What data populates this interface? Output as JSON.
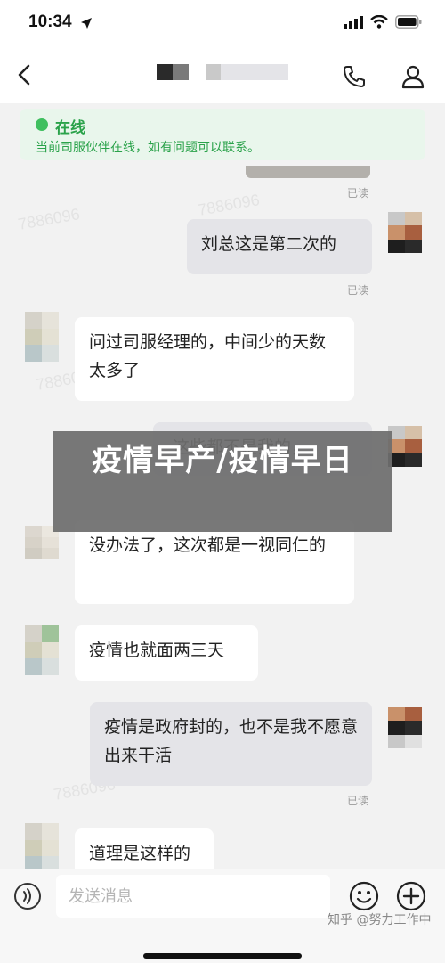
{
  "status_bar": {
    "time": "10:34",
    "icons": [
      "location-arrow-icon",
      "signal-icon",
      "wifi-icon",
      "battery-icon"
    ]
  },
  "header": {
    "back_icon": "back-chevron-icon",
    "title_redacted": true,
    "call_icon": "phone-icon",
    "profile_icon": "person-icon"
  },
  "online_banner": {
    "title": "在线",
    "description": "当前司服伙伴在线，如有问题可以联系。",
    "color": "#2aa24a"
  },
  "watermark_text": "7886096",
  "messages": [
    {
      "side": "right",
      "text": "刘总这是第二次的",
      "read": "已读"
    },
    {
      "side": "left",
      "text": "问过司服经理的，中间少的天数太多了"
    },
    {
      "side": "right",
      "text": "这些都不是我的，",
      "obscured": true
    },
    {
      "side": "left",
      "text": "没办法了，这次都是一视同仁的"
    },
    {
      "side": "left",
      "text": "疫情也就面两三天"
    },
    {
      "side": "right",
      "text": "疫情是政府封的，也不是我不愿意出来干活",
      "read": "已读"
    },
    {
      "side": "left",
      "text": "道理是这样的"
    }
  ],
  "read_labels": [
    "已读",
    "已读",
    "已读"
  ],
  "overlay_title": "疫情早产/疫情早日",
  "input_bar": {
    "voice_icon": "voice-icon",
    "placeholder": "发送消息",
    "emoji_icon": "emoji-icon",
    "plus_icon": "plus-icon"
  },
  "source_watermark": "知乎 @努力工作中"
}
